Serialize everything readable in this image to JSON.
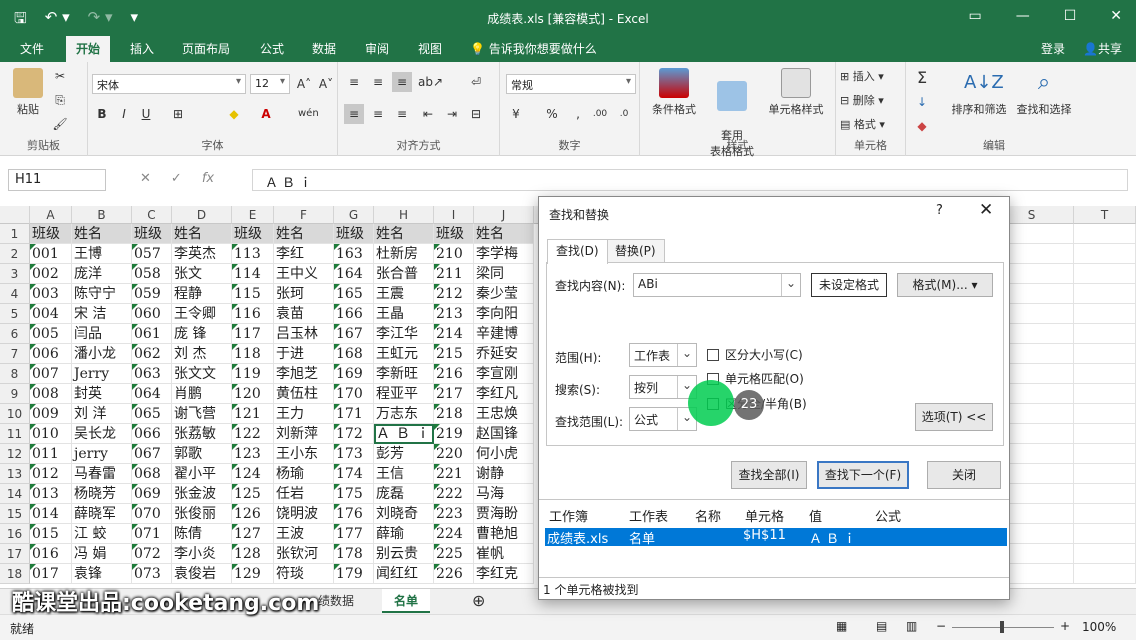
{
  "window": {
    "title": "成绩表.xls  [兼容模式] - Excel"
  },
  "ribbon_tabs": [
    "文件",
    "开始",
    "插入",
    "页面布局",
    "公式",
    "数据",
    "审阅",
    "视图"
  ],
  "tell_me": "告诉我你想要做什么",
  "account": {
    "login": "登录",
    "share": "共享"
  },
  "ribbon": {
    "clipboard": {
      "paste": "粘贴",
      "label": "剪贴板"
    },
    "font": {
      "name": "宋体",
      "size": "12",
      "label": "字体"
    },
    "alignment": {
      "label": "对齐方式"
    },
    "number": {
      "format": "常规",
      "label": "数字"
    },
    "styles": {
      "cond": "条件格式",
      "table": "套用\n表格格式",
      "cell": "单元格样式",
      "label": "样式"
    },
    "cells": {
      "insert": "插入",
      "delete": "删除",
      "format": "格式",
      "label": "单元格"
    },
    "editing": {
      "sort": "排序和筛选",
      "find": "查找和选择",
      "label": "编辑"
    }
  },
  "formula_bar": {
    "name_box": "H11",
    "formula": "ＡＢｉ"
  },
  "columns": [
    "A",
    "B",
    "C",
    "D",
    "E",
    "F",
    "G",
    "H",
    "I",
    "J",
    "S",
    "T"
  ],
  "rows": [
    [
      "班级",
      "姓名",
      "班级",
      "姓名",
      "班级",
      "姓名",
      "班级",
      "姓名",
      "班级",
      "姓名"
    ],
    [
      "001",
      "王博",
      "057",
      "李英杰",
      "113",
      "李红",
      "163",
      "杜新房",
      "210",
      "李学梅"
    ],
    [
      "002",
      "庞洋",
      "058",
      "张文",
      "114",
      "王中义",
      "164",
      "张合普",
      "211",
      "梁同"
    ],
    [
      "003",
      "陈守宁",
      "059",
      "程静",
      "115",
      "张珂",
      "165",
      "王震",
      "212",
      "秦少莹"
    ],
    [
      "004",
      "宋  洁",
      "060",
      "王令卿",
      "116",
      "袁苗",
      "166",
      "王晶",
      "213",
      "李向阳"
    ],
    [
      "005",
      "闫品",
      "061",
      "庞  锋",
      "117",
      "吕玉林",
      "167",
      "李江华",
      "214",
      "辛建博"
    ],
    [
      "006",
      "潘小龙",
      "062",
      "刘  杰",
      "118",
      "于进",
      "168",
      "王虹元",
      "215",
      "乔延安"
    ],
    [
      "007",
      "Jerry",
      "063",
      "张文文",
      "119",
      "李旭芝",
      "169",
      "李新旺",
      "216",
      "李宣刚"
    ],
    [
      "008",
      "封英",
      "064",
      "肖鹏",
      "120",
      "黄伍柱",
      "170",
      "程亚平",
      "217",
      "李红凡"
    ],
    [
      "009",
      "刘  洋",
      "065",
      "谢飞营",
      "121",
      "王力",
      "171",
      "万志东",
      "218",
      "王忠焕"
    ],
    [
      "010",
      "吴长龙",
      "066",
      "张荔敏",
      "122",
      "刘新萍",
      "172",
      "ＡＢｉ",
      "219",
      "赵国锋"
    ],
    [
      "011",
      "jerry",
      "067",
      "郭歌",
      "123",
      "王小东",
      "173",
      "彭芳",
      "220",
      "何小虎"
    ],
    [
      "012",
      "马春雷",
      "068",
      "翟小平",
      "124",
      "杨瑜",
      "174",
      "王信",
      "221",
      "谢静"
    ],
    [
      "013",
      "杨晓芳",
      "069",
      "张金波",
      "125",
      "任岩",
      "175",
      "庞磊",
      "222",
      "马海"
    ],
    [
      "014",
      "薛晓军",
      "070",
      "张俊丽",
      "126",
      "饶明波",
      "176",
      "刘晓奇",
      "223",
      "贾海盼"
    ],
    [
      "015",
      "江  蛟",
      "071",
      "陈倩",
      "127",
      "王波",
      "177",
      "薛瑜",
      "224",
      "曹艳旭"
    ],
    [
      "016",
      "冯  娟",
      "072",
      "李小炎",
      "128",
      "张钦河",
      "178",
      "别云贵",
      "225",
      "崔帆"
    ],
    [
      "017",
      "袁锋",
      "073",
      "袁俊岩",
      "129",
      "符琰",
      "179",
      "闻红红",
      "226",
      "李红克"
    ]
  ],
  "sheets": [
    "绩数据",
    "名单"
  ],
  "active_sheet": "名单",
  "status": {
    "ready": "就绪",
    "zoom": "100%"
  },
  "watermark": "酷课堂出品:cooketang.com",
  "dialog": {
    "title": "查找和替换",
    "help": "?",
    "tab_find": "查找(D)",
    "tab_replace": "替换(P)",
    "find_label": "查找内容(N):",
    "find_value": "ABi",
    "no_format": "未设定格式",
    "format_btn": "格式(M)...",
    "scope_label": "范围(H):",
    "scope_value": "工作表",
    "search_label": "搜索(S):",
    "search_value": "按列",
    "lookin_label": "查找范围(L):",
    "lookin_value": "公式",
    "match_case": "区分大小写(C)",
    "match_cell": "单元格匹配(O)",
    "match_width": "区分全/半角(B)",
    "options_btn": "选项(T) <<",
    "find_all": "查找全部(I)",
    "find_next": "查找下一个(F)",
    "close": "关闭",
    "result_headers": [
      "工作簿",
      "工作表",
      "名称",
      "单元格",
      "值",
      "公式"
    ],
    "result_row": [
      "成绩表.xls",
      "名单",
      "",
      "$H$11",
      "ＡＢｉ",
      ""
    ],
    "status": "1 个单元格被找到"
  },
  "cursor_badge": "23"
}
